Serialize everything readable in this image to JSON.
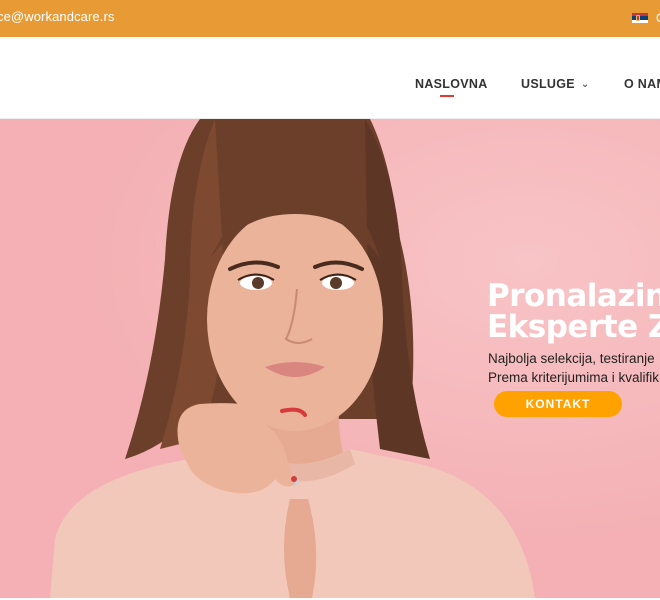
{
  "topbar": {
    "email": "ce@workandcare.rs",
    "lang_text": "C",
    "flag_icon": "serbia-flag-icon",
    "bg_color": "#e89b34"
  },
  "nav": {
    "items": [
      {
        "label": "NASLOVNA",
        "active": true
      },
      {
        "label": "USLUGE",
        "has_dropdown": true
      },
      {
        "label": "O NAM"
      }
    ],
    "active_color": "#e53935"
  },
  "hero": {
    "title_line1": "Pronalazin",
    "title_line2": "Eksperte Ze",
    "subtitle_line1": "Najbolja selekcija, testiranje",
    "subtitle_line2": "Prema kriterijumima i kvalifik",
    "cta_label": "KONTAKT",
    "cta_color": "#ffa200",
    "bg_color": "#f4b0b4"
  }
}
